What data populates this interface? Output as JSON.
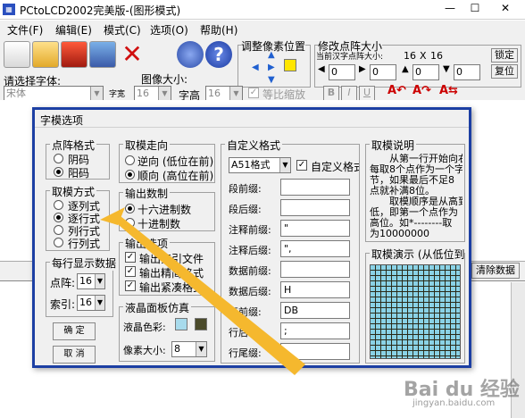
{
  "app": {
    "title": "PCtoLCD2002完美版-(图形模式)",
    "window_buttons": [
      "—",
      "☐",
      "✕"
    ]
  },
  "menu": [
    "文件(F)",
    "编辑(E)",
    "模式(C)",
    "选项(O)",
    "帮助(H)"
  ],
  "toolbar": {
    "font_label": "请选择字体:",
    "font_value": "宋体",
    "char_width_label": "字宽",
    "char_width_value": "16",
    "image_size_label": "图像大小:",
    "image_size_value": "16",
    "char_height_label": "字高",
    "char_height_value": "16",
    "scale_label": "等比缩放",
    "style_buttons": [
      "B",
      "I",
      "U"
    ],
    "pixel_adjust_label": "调整像素位置",
    "dot_matrix_size_label": "修改点阵大小",
    "current_size_label": "当前汉字点阵大小:",
    "size_x": "16",
    "size_sep": "X",
    "size_y": "16",
    "stepper_values": [
      "0",
      "0",
      "0",
      "0"
    ],
    "lock_button": "锁定",
    "restore_button": "复位",
    "clear_button": "清除数据"
  },
  "dialog": {
    "title": "字模选项",
    "dot_format": {
      "title": "点阵格式",
      "options": [
        "阴码",
        "阳码"
      ],
      "selected": "阳码"
    },
    "scan_mode": {
      "title": "取模方式",
      "options": [
        "逐列式",
        "逐行式",
        "列行式",
        "行列式"
      ],
      "selected": "逐行式"
    },
    "per_line": {
      "title": "每行显示数据",
      "dots_label": "点阵:",
      "dots_value": "16",
      "index_label": "索引:",
      "index_value": "16"
    },
    "ok_button": "确 定",
    "cancel_button": "取 消",
    "direction": {
      "title": "取模走向",
      "options": [
        "逆向 (低位在前)",
        "顺向 (高位在前)"
      ],
      "selected": "顺向 (高位在前)"
    },
    "output_radix": {
      "title": "输出数制",
      "options": [
        "十六进制数",
        "十进制数"
      ],
      "selected": "十六进制数"
    },
    "output_options": {
      "title": "输出选项",
      "items": [
        "输出索引文件",
        "输出精简格式",
        "输出紧凑格式"
      ],
      "checked": [
        true,
        true,
        true
      ]
    },
    "lcd_panel": {
      "title": "液晶面板仿真",
      "color_label": "液晶色彩:",
      "color_light": "#a8dbec",
      "color_dark": "#4a4a2a",
      "pixel_size_label": "像素大小:",
      "pixel_size_value": "8"
    },
    "custom_format": {
      "title": "自定义格式",
      "format_value": "A51格式",
      "custom_check_label": "自定义格式",
      "custom_checked": true,
      "fields": [
        {
          "label": "段前缀:",
          "value": ""
        },
        {
          "label": "段后缀:",
          "value": ""
        },
        {
          "label": "注释前缀:",
          "value": "\""
        },
        {
          "label": "注释后缀:",
          "value": "\","
        },
        {
          "label": "数据前缀:",
          "value": ""
        },
        {
          "label": "数据后缀:",
          "value": "H"
        },
        {
          "label": "行前缀:",
          "value": "DB"
        },
        {
          "label": "行后缀:",
          "value": ";"
        },
        {
          "label": "行尾缀:",
          "value": ""
        }
      ]
    },
    "description": {
      "title": "取模说明",
      "lines": [
        "从第一行开始向右",
        "每取8个点作为一个字",
        "节，如果最后不足8",
        "点就补满8位。",
        "取模顺序是从高到",
        "低，即第一个点作为",
        "高位。如*--------取",
        "为10000000"
      ]
    },
    "demo": {
      "title": "取模演示 (从低位到"
    }
  },
  "colors": {
    "dialog_border": "#1c3fa3",
    "arrow": "#f5b82e",
    "preview_light": "#8ad2e6",
    "preview_dark": "#2a2a18"
  },
  "watermark": "Bai du 经验",
  "watermark_url": "jingyan.baidu.com"
}
